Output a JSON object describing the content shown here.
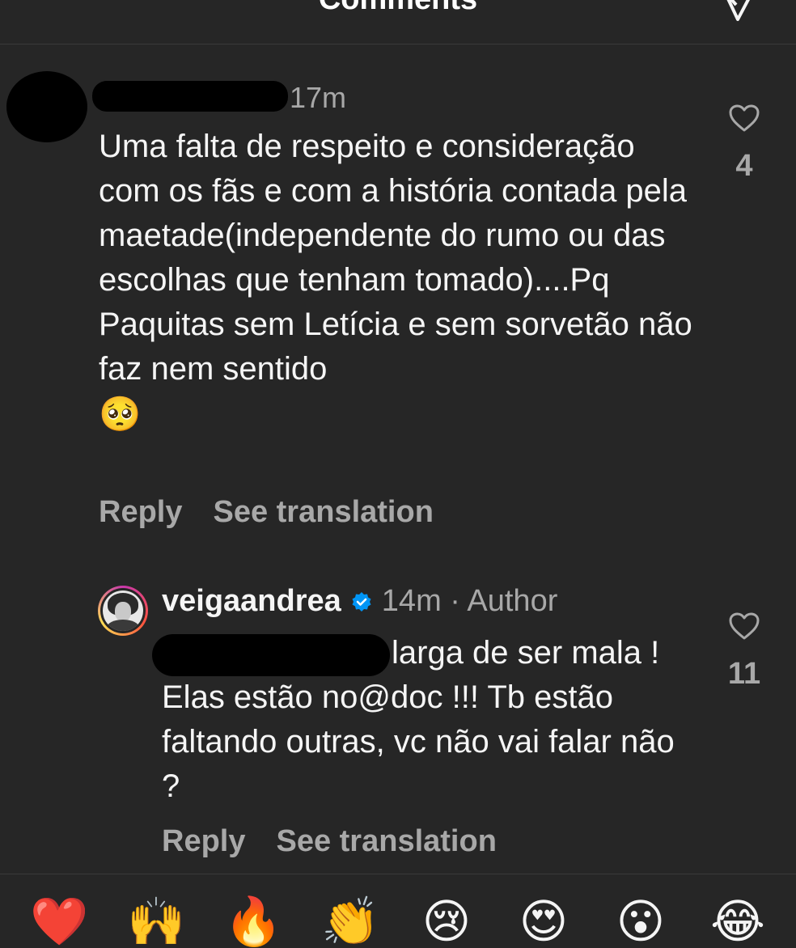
{
  "header": {
    "title": "Comments",
    "icon": "send-icon"
  },
  "comments": [
    {
      "time": "17m",
      "text": "Uma falta de respeito e consideração com os fãs e com a história contada pela maetade(independente do rumo ou das escolhas que tenham tomado)....Pq Paquitas sem Letícia e sem sorvetão não faz nem sentido",
      "emoji": "🥺",
      "reply_label": "Reply",
      "translate_label": "See translation",
      "likes": "4"
    }
  ],
  "reply": {
    "username": "veigaandrea",
    "verified": true,
    "meta": "14m · Author",
    "text_first": "larga de ser mala !",
    "text_rest": "Elas estão no@doc !!! Tb estão faltando outras, vc não vai falar não ?",
    "reply_label": "Reply",
    "translate_label": "See translation",
    "likes": "11"
  },
  "reactions": [
    "❤️",
    "🙌",
    "🔥",
    "👏",
    "😢",
    "😍",
    "😮",
    "😂"
  ],
  "colors": {
    "background": "#262626",
    "text": "#f5f5f5",
    "muted": "#a8a8a8",
    "verified": "#0095f6"
  }
}
